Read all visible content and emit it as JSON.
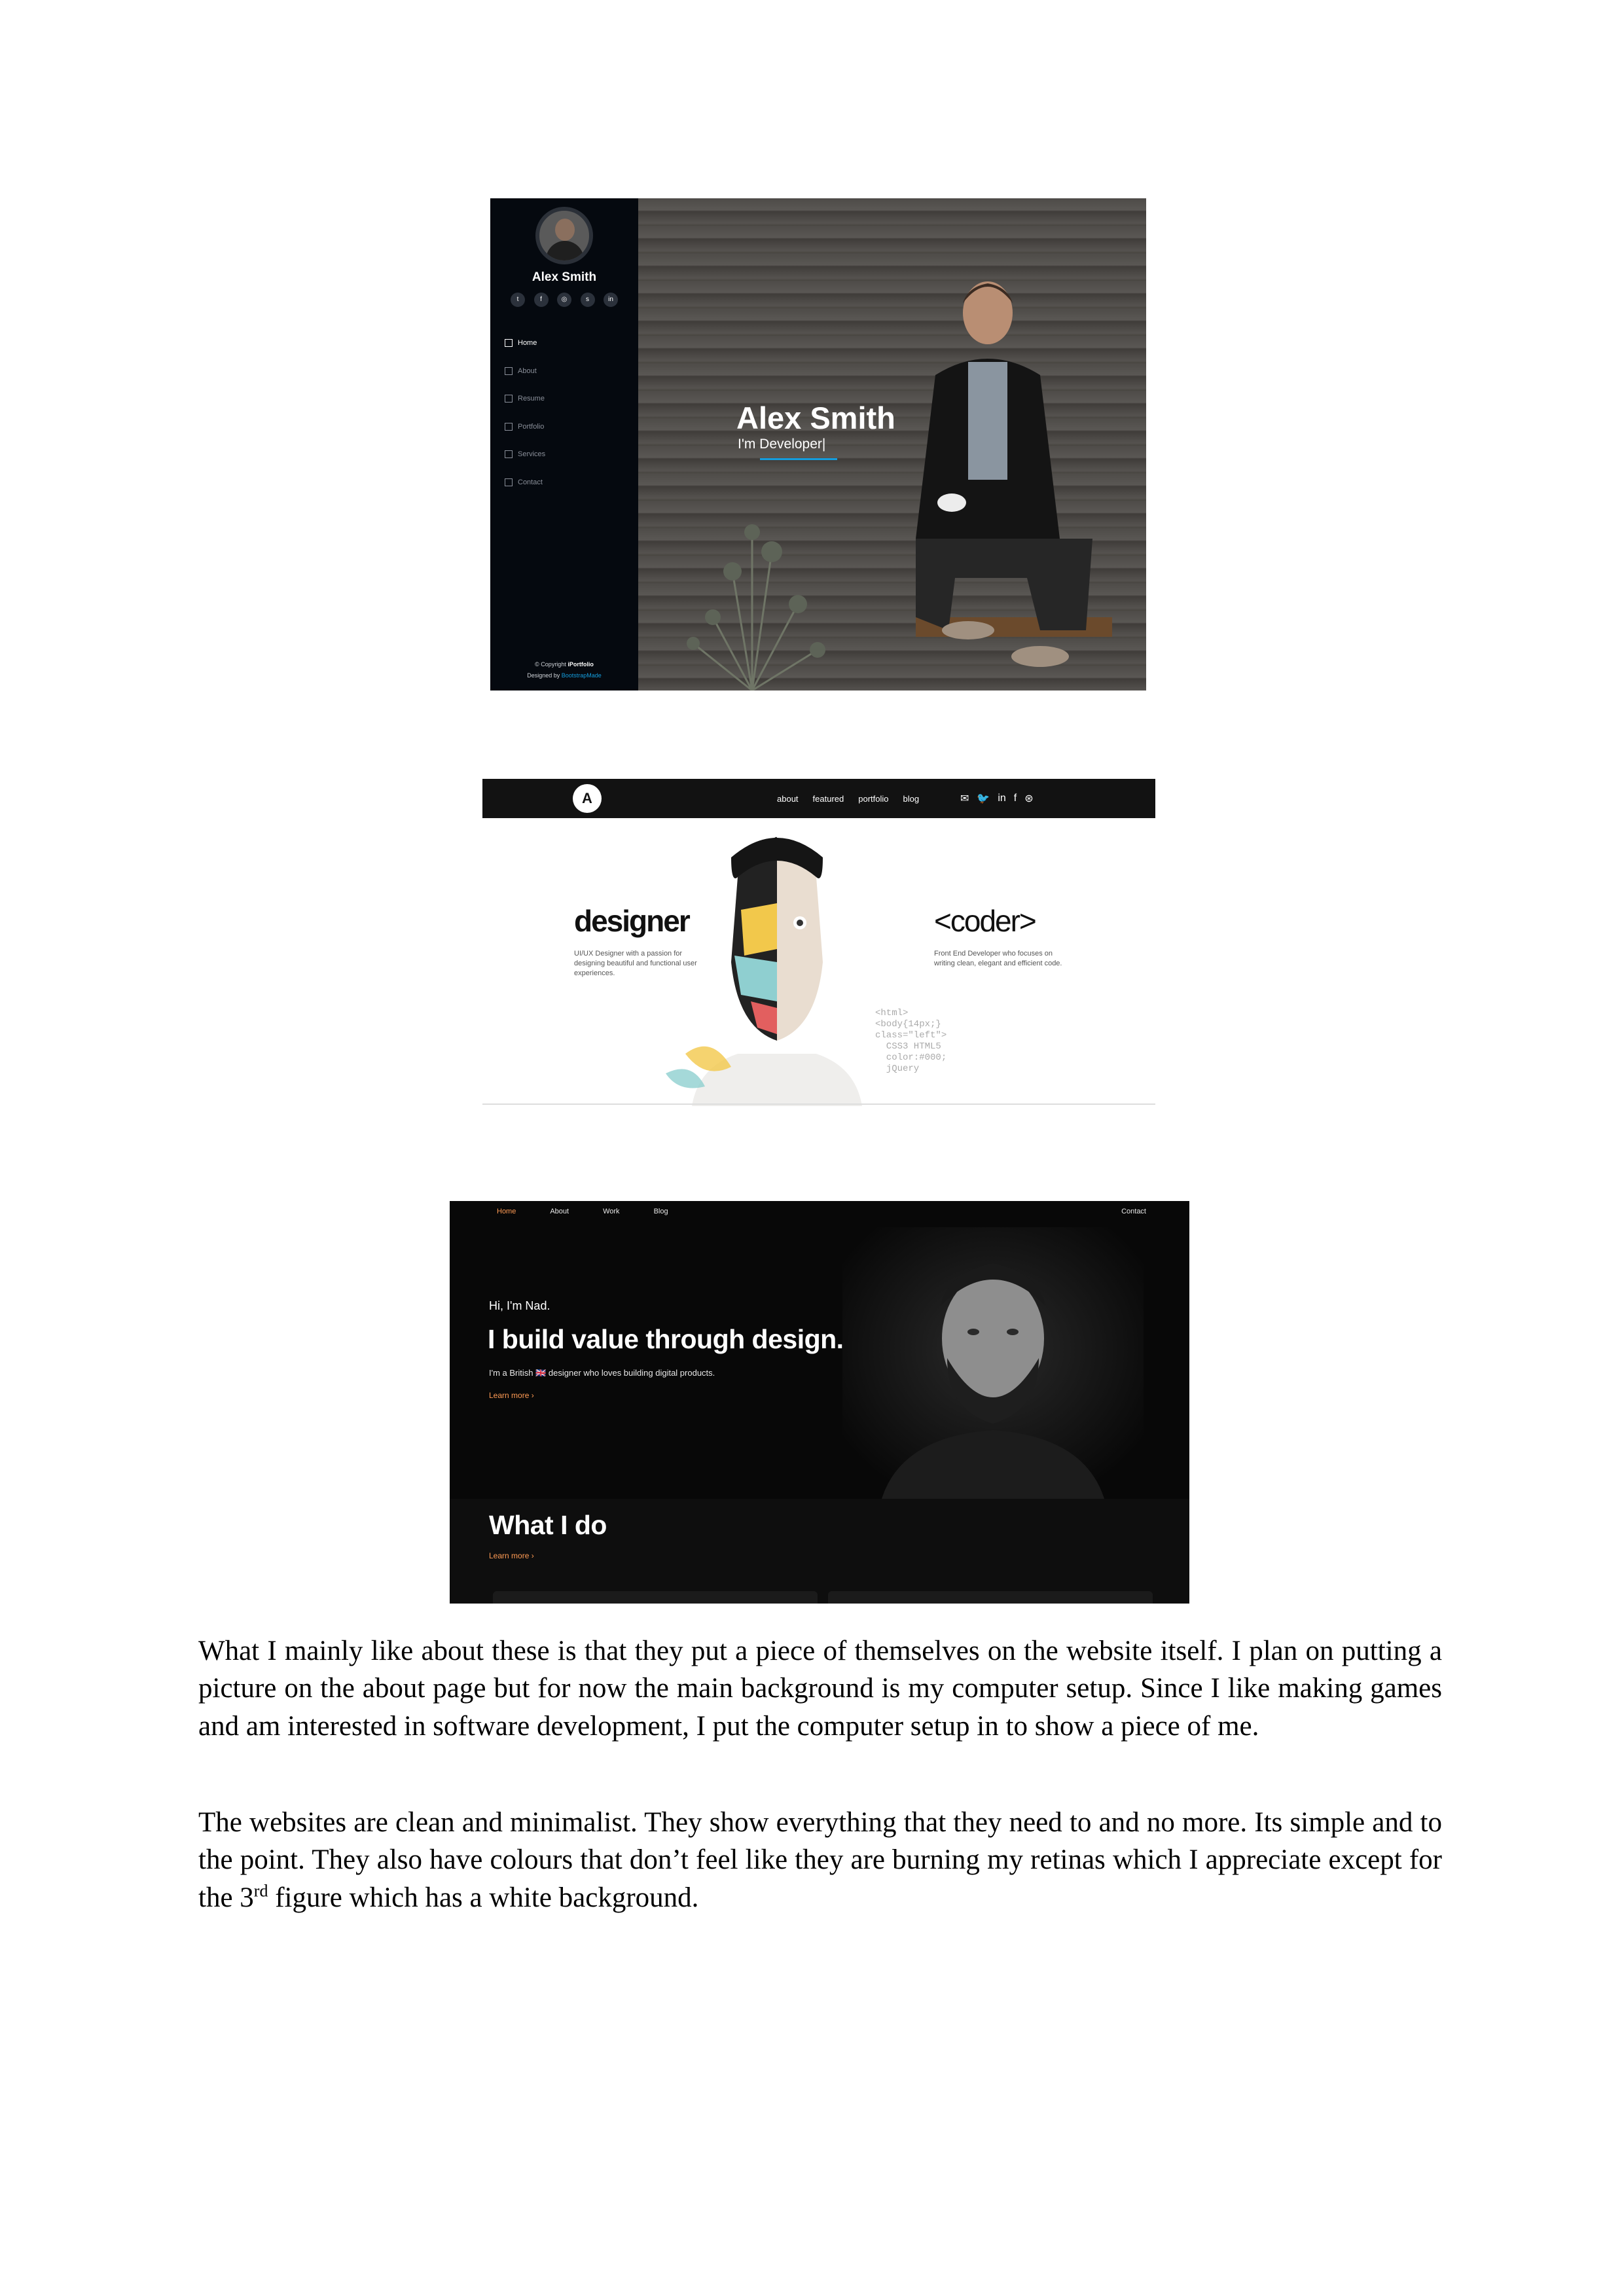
{
  "figure1": {
    "sidebar_name": "Alex Smith",
    "social_icons": [
      "twitter-icon",
      "facebook-icon",
      "instagram-icon",
      "skype-icon",
      "linkedin-icon"
    ],
    "social_glyphs": [
      "t",
      "f",
      "◎",
      "s",
      "in"
    ],
    "nav": [
      {
        "label": "Home",
        "icon": "home-icon"
      },
      {
        "label": "About",
        "icon": "user-icon"
      },
      {
        "label": "Resume",
        "icon": "file-icon"
      },
      {
        "label": "Portfolio",
        "icon": "book-icon"
      },
      {
        "label": "Services",
        "icon": "server-icon"
      },
      {
        "label": "Contact",
        "icon": "envelope-icon"
      }
    ],
    "footer_line1_prefix": "© Copyright ",
    "footer_brand": "iPortfolio",
    "footer_line2_prefix": "Designed by ",
    "footer_designer": "BootstrapMade",
    "hero_title": "Alex Smith",
    "hero_subtitle": "I'm Developer|",
    "accent": "#149ddd"
  },
  "figure2": {
    "logo_letter": "A",
    "nav": [
      "about",
      "featured",
      "portfolio",
      "blog"
    ],
    "social_icons": [
      "envelope-icon",
      "twitter-icon",
      "linkedin-icon",
      "facebook-icon",
      "dribbble-icon"
    ],
    "social_glyphs": [
      "✉",
      "🐦",
      "in",
      "f",
      "⊛"
    ],
    "left_heading": "designer",
    "left_desc": "UI/UX Designer with a passion for designing beautiful and functional user experiences.",
    "right_heading": "<coder>",
    "right_desc": "Front End Developer who focuses on writing clean, elegant and efficient code.",
    "code_snippet": "<html>\n<body{14px;}\nclass=\"left\">\n  CSS3 HTML5\n  color:#000;\n  jQuery"
  },
  "figure3": {
    "nav": [
      "Home",
      "About",
      "Work",
      "Blog"
    ],
    "contact": "Contact",
    "greeting": "Hi, I'm Nad.",
    "headline": "I build value through design.",
    "subline": "I'm a British 🇬🇧 designer who loves building digital products.",
    "learn_more": "Learn more ›",
    "section_title": "What I do",
    "section_link": "Learn more ›",
    "accent": "#ff9b54"
  },
  "body": {
    "paragraph1": "What I mainly like about these is that they put a piece of themselves on the website itself. I plan on putting a picture on the about page but for now the main background is my computer setup. Since I like making games and am interested in software development, I put the computer setup in to show a piece of me.",
    "paragraph2_before": "The websites are clean and minimalist. They show everything that they need to and no more. Its simple and to the point. They also have colours that don’t feel like they are burning my retinas which I appreciate except for the 3",
    "paragraph2_sup": "rd",
    "paragraph2_after": " figure which has a white background."
  }
}
